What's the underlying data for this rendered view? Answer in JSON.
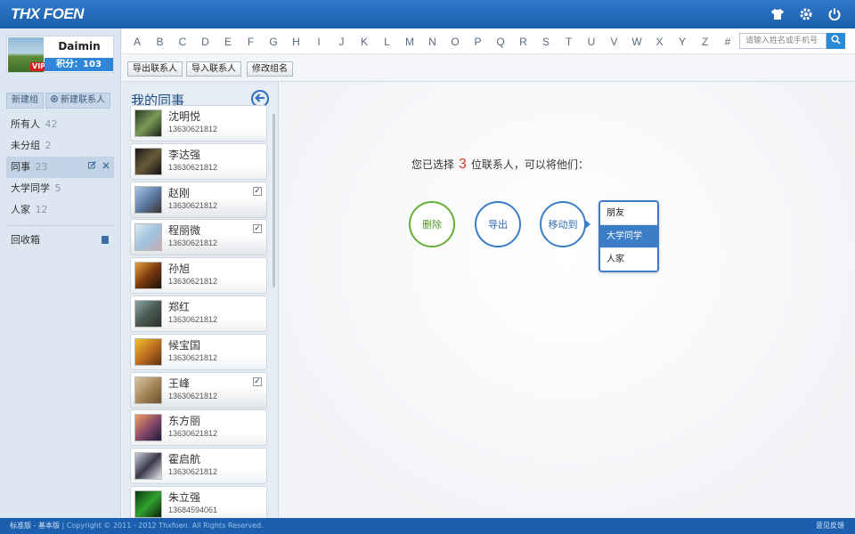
{
  "brand": "THX FOEN",
  "profile": {
    "name": "Daimin",
    "badge": "VIP",
    "points": "积分：103"
  },
  "sidebar": {
    "new_group": "新建组",
    "new_contact": "新建联系人",
    "groups": [
      {
        "label": "所有人",
        "count": "42"
      },
      {
        "label": "未分组",
        "count": "2"
      },
      {
        "label": "同事",
        "count": "23"
      },
      {
        "label": "大学同学",
        "count": "5"
      },
      {
        "label": "人家",
        "count": "12"
      }
    ],
    "trash": "回收箱"
  },
  "letters": [
    "A",
    "B",
    "C",
    "D",
    "E",
    "F",
    "G",
    "H",
    "I",
    "J",
    "K",
    "L",
    "M",
    "N",
    "O",
    "P",
    "Q",
    "R",
    "S",
    "T",
    "U",
    "V",
    "W",
    "X",
    "Y",
    "Z",
    "#"
  ],
  "search": {
    "placeholder": "请输入姓名或手机号"
  },
  "actions": {
    "export": "导出联系人",
    "import": "导入联系人",
    "rename": "修改组名"
  },
  "list": {
    "title": "我的同事",
    "contacts": [
      {
        "name": "沈明悦",
        "phone": "13630621812",
        "checked": false
      },
      {
        "name": "李达强",
        "phone": "13630621812",
        "checked": false
      },
      {
        "name": "赵刚",
        "phone": "13630621812",
        "checked": true
      },
      {
        "name": "程丽微",
        "phone": "13630621812",
        "checked": true
      },
      {
        "name": "孙旭",
        "phone": "13630621812",
        "checked": false
      },
      {
        "name": "郑红",
        "phone": "13630621812",
        "checked": false
      },
      {
        "name": "候宝国",
        "phone": "13630621812",
        "checked": false
      },
      {
        "name": "王峰",
        "phone": "13630621812",
        "checked": true
      },
      {
        "name": "东方丽",
        "phone": "13630621812",
        "checked": false
      },
      {
        "name": "霍启航",
        "phone": "13630621812",
        "checked": false
      },
      {
        "name": "朱立强",
        "phone": "13684594061",
        "checked": false
      }
    ]
  },
  "main": {
    "prefix": "您已选择",
    "count": "3",
    "suffix": "位联系人，可以将他们：",
    "delete": "删除",
    "export": "导出",
    "move": "移动到",
    "move_options": [
      "朋友",
      "大学同学",
      "人家"
    ],
    "highlighted_option": "大学同学"
  },
  "footer": {
    "standard": "标准版",
    "basic": "基本版",
    "copyright": "| Copyright © 2011 - 2012 Thxfoen. All Rights Reserved.",
    "feedback": "意见反馈"
  },
  "colors": {
    "primary": "#1b5fae",
    "accent": "#3b7dc6",
    "delete": "#6aaf3a",
    "highlight_number": "#d63a1e"
  }
}
